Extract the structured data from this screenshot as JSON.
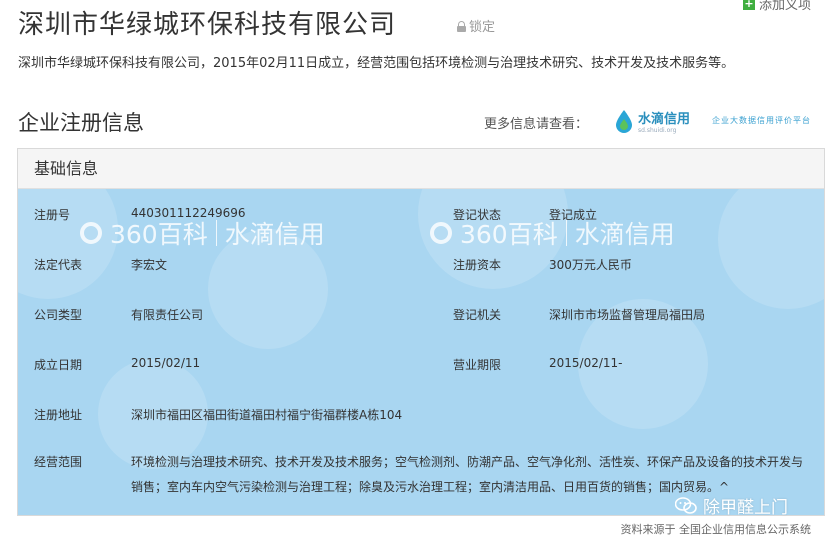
{
  "company": {
    "name": "深圳市华绿城环保科技有限公司",
    "lock_label": "锁定",
    "add_entry": "添加义项",
    "summary": "深圳市华绿城环保科技有限公司，2015年02月11日成立，经营范围包括环境检测与治理技术研究、技术开发及技术服务等。"
  },
  "section": {
    "title": "企业注册信息",
    "more_info": "更多信息请查看：",
    "brand_name": "水滴信用",
    "brand_sub": "sd.shuidi.org",
    "brand_slogan": "企业大数据信用评价平台"
  },
  "card": {
    "header": "基础信息",
    "watermark_text": "360百科",
    "watermark_brand": "水滴信用",
    "rows": [
      {
        "label": "注册号",
        "value": "440301112249696",
        "label2": "登记状态",
        "value2": "登记成立"
      },
      {
        "label": "法定代表",
        "value": "李宏文",
        "label2": "注册资本",
        "value2": "300万元人民币"
      },
      {
        "label": "公司类型",
        "value": "有限责任公司",
        "label2": "登记机关",
        "value2": "深圳市市场监督管理局福田局"
      },
      {
        "label": "成立日期",
        "value": "2015/02/11",
        "label2": "营业期限",
        "value2": "2015/02/11-"
      },
      {
        "label": "注册地址",
        "value": "深圳市福田区福田街道福田村福宁街福群楼A栋104"
      }
    ],
    "scope_label": "经营范围",
    "scope_value": "环境检测与治理技术研究、技术开发及技术服务；空气检测剂、防潮产品、空气净化剂、活性炭、环保产品及设备的技术开发与销售；室内车内空气污染检测与治理工程；除臭及污水治理工程；室内清洁用品、日用百货的销售；国内贸易。^"
  },
  "footer": {
    "source": "资料来源于 全国企业信用信息公示系统",
    "wechat_account": "除甲醛上门"
  },
  "colors": {
    "card_bg": "#a9d6f1",
    "brand_blue": "#2a8fbd",
    "add_green": "#3fae3f"
  }
}
